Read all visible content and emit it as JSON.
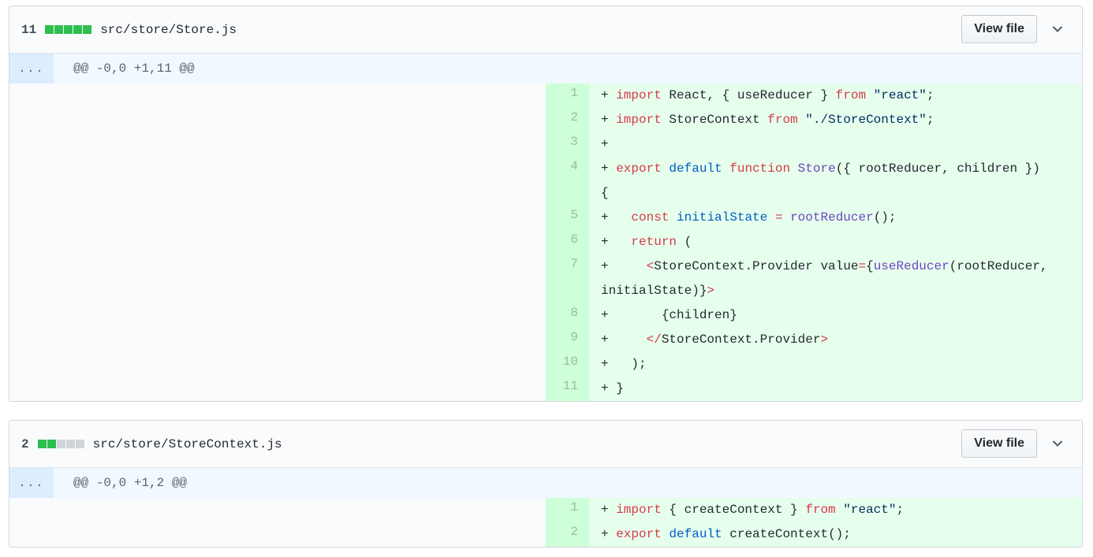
{
  "files": [
    {
      "additions": "11",
      "diffstat": [
        "add",
        "add",
        "add",
        "add",
        "add"
      ],
      "path": "src/store/Store.js",
      "view_file_label": "View file",
      "hunk_expand": "...",
      "hunk_header": "@@ -0,0 +1,11 @@",
      "lines": [
        {
          "num": "1",
          "wrap": false,
          "tokens": [
            [
              "",
              "+ "
            ],
            [
              "k",
              "import"
            ],
            [
              "",
              " React, { useReducer } "
            ],
            [
              "k",
              "from"
            ],
            [
              "",
              " "
            ],
            [
              "s",
              "\"react\""
            ],
            [
              "",
              ";"
            ]
          ]
        },
        {
          "num": "2",
          "wrap": false,
          "tokens": [
            [
              "",
              "+ "
            ],
            [
              "k",
              "import"
            ],
            [
              "",
              " StoreContext "
            ],
            [
              "k",
              "from"
            ],
            [
              "",
              " "
            ],
            [
              "s",
              "\"./StoreContext\""
            ],
            [
              "",
              ";"
            ]
          ]
        },
        {
          "num": "3",
          "wrap": false,
          "tokens": [
            [
              "",
              "+ "
            ]
          ]
        },
        {
          "num": "4",
          "wrap": true,
          "tokens": [
            [
              "",
              "+ "
            ],
            [
              "k",
              "export"
            ],
            [
              "",
              " "
            ],
            [
              "c",
              "default"
            ],
            [
              "",
              " "
            ],
            [
              "k",
              "function"
            ],
            [
              "",
              " "
            ],
            [
              "f",
              "Store"
            ],
            [
              "",
              "({ rootReducer, children })\n{"
            ]
          ]
        },
        {
          "num": "5",
          "wrap": false,
          "tokens": [
            [
              "",
              "+   "
            ],
            [
              "k",
              "const"
            ],
            [
              "",
              " "
            ],
            [
              "c",
              "initialState"
            ],
            [
              "",
              " "
            ],
            [
              "k",
              "="
            ],
            [
              "",
              " "
            ],
            [
              "f",
              "rootReducer"
            ],
            [
              "",
              "();"
            ]
          ]
        },
        {
          "num": "6",
          "wrap": false,
          "tokens": [
            [
              "",
              "+   "
            ],
            [
              "k",
              "return"
            ],
            [
              "",
              " ("
            ]
          ]
        },
        {
          "num": "7",
          "wrap": true,
          "tokens": [
            [
              "",
              "+     "
            ],
            [
              "k",
              "<"
            ],
            [
              "",
              "StoreContext.Provider value"
            ],
            [
              "k",
              "="
            ],
            [
              "",
              "{"
            ],
            [
              "f",
              "useReducer"
            ],
            [
              "",
              "(rootReducer,\ninitialState)}"
            ],
            [
              "k",
              ">"
            ]
          ]
        },
        {
          "num": "8",
          "wrap": false,
          "tokens": [
            [
              "",
              "+       {children}"
            ]
          ]
        },
        {
          "num": "9",
          "wrap": false,
          "tokens": [
            [
              "",
              "+     "
            ],
            [
              "k",
              "</"
            ],
            [
              "",
              "StoreContext.Provider"
            ],
            [
              "k",
              ">"
            ]
          ]
        },
        {
          "num": "10",
          "wrap": false,
          "tokens": [
            [
              "",
              "+   );"
            ]
          ]
        },
        {
          "num": "11",
          "wrap": false,
          "tokens": [
            [
              "",
              "+ }"
            ]
          ]
        }
      ]
    },
    {
      "additions": "2",
      "diffstat": [
        "add",
        "add",
        "neutral",
        "neutral",
        "neutral"
      ],
      "path": "src/store/StoreContext.js",
      "view_file_label": "View file",
      "hunk_expand": "...",
      "hunk_header": "@@ -0,0 +1,2 @@",
      "lines": [
        {
          "num": "1",
          "wrap": false,
          "tokens": [
            [
              "",
              "+ "
            ],
            [
              "k",
              "import"
            ],
            [
              "",
              " { createContext } "
            ],
            [
              "k",
              "from"
            ],
            [
              "",
              " "
            ],
            [
              "s",
              "\"react\""
            ],
            [
              "",
              ";"
            ]
          ]
        },
        {
          "num": "2",
          "wrap": false,
          "tokens": [
            [
              "",
              "+ "
            ],
            [
              "k",
              "export"
            ],
            [
              "",
              " "
            ],
            [
              "c",
              "default"
            ],
            [
              "",
              " createContext();"
            ]
          ]
        }
      ]
    }
  ]
}
